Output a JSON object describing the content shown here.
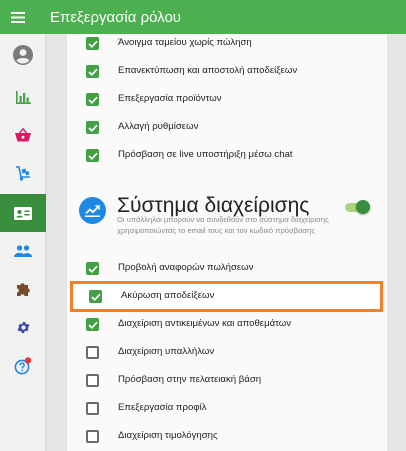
{
  "header": {
    "title": "Επεξεργασία ρόλου"
  },
  "sidebar": {
    "items": [
      {
        "name": "account",
        "icon": "account-circle-icon",
        "active": false
      },
      {
        "name": "reports",
        "icon": "bar-chart-icon",
        "active": false
      },
      {
        "name": "sales",
        "icon": "shopping-basket-icon",
        "active": false
      },
      {
        "name": "inventory",
        "icon": "delivery-cart-icon",
        "active": false
      },
      {
        "name": "employees",
        "icon": "id-card-icon",
        "active": true
      },
      {
        "name": "customers",
        "icon": "people-icon",
        "active": false
      },
      {
        "name": "integrations",
        "icon": "puzzle-icon",
        "active": false
      },
      {
        "name": "settings",
        "icon": "gear-icon",
        "active": false
      },
      {
        "name": "help",
        "icon": "help-icon",
        "active": false,
        "has_badge": true
      }
    ]
  },
  "pos_permissions": [
    {
      "label": "Άνοιγμα ταμείου χωρίς πώληση",
      "checked": true
    },
    {
      "label": "Επανεκτύπωση και αποστολή αποδείξεων",
      "checked": true
    },
    {
      "label": "Επεξεργασία προϊόντων",
      "checked": true
    },
    {
      "label": "Αλλαγή ρυθμίσεων",
      "checked": true
    },
    {
      "label": "Πρόσβαση σε live υποστήριξη μέσω chat",
      "checked": true
    }
  ],
  "backoffice": {
    "title": "Σύστημα διαχείρισης",
    "description": "Οι υπάλληλοι μπορούν να συνδεθούν στο σύστημα διαχείρισης χρησιμοποιώντας το email τους και τον κωδικό πρόσβασης",
    "enabled": true,
    "permissions": [
      {
        "label": "Προβολή αναφορών πωλήσεων",
        "checked": true
      },
      {
        "label": "Ακύρωση αποδείξεων",
        "checked": true,
        "highlighted": true
      },
      {
        "label": "Διαχείριση αντικειμένων και αποθεμάτων",
        "checked": true
      },
      {
        "label": "Διαχείριση υπαλλήλων",
        "checked": false
      },
      {
        "label": "Πρόσβαση στην πελατειακή βάση",
        "checked": false
      },
      {
        "label": "Επεξεργασία προφίλ",
        "checked": false
      },
      {
        "label": "Διαχείριση τιμολόγησης",
        "checked": false
      }
    ]
  },
  "colors": {
    "primary": "#4caf50",
    "active_nav": "#388e3c",
    "highlight": "#f0812c"
  }
}
